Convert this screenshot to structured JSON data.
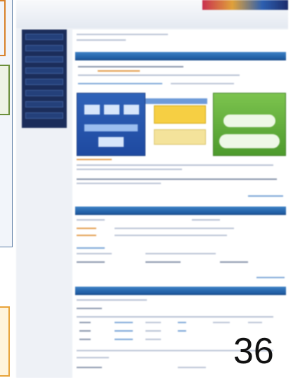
{
  "page_number": "36",
  "screenshot": {
    "header": {
      "logo_text": "",
      "logo_subtitle": "",
      "link_text": ""
    },
    "sidebar": {
      "items": []
    },
    "main": {
      "section_titles": []
    }
  },
  "colors": {
    "section_bar": "#1d5aa0",
    "sidebar": "#1b2d5a",
    "diagram_blue": "#2f62b8",
    "diagram_yellow": "#f6cf43",
    "diagram_green": "#4d9a2c",
    "accent_orange": "#e39b4a"
  }
}
